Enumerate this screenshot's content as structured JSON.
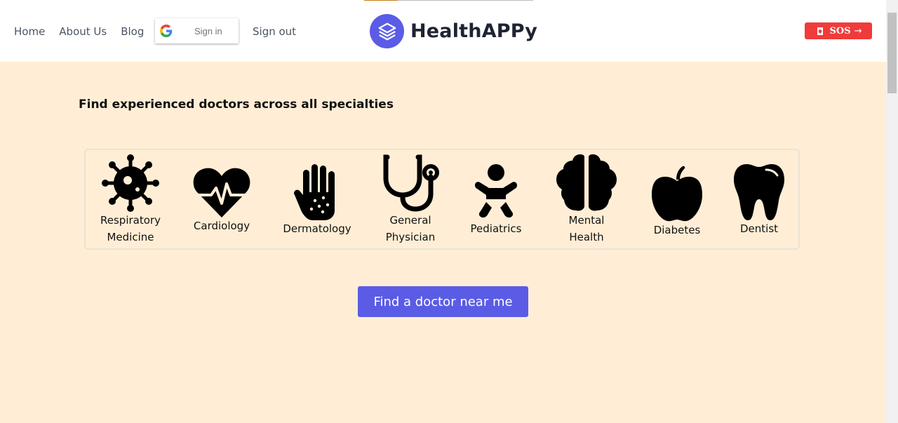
{
  "page": {
    "progress_fraction": 0.2
  },
  "nav": {
    "home": "Home",
    "about": "About Us",
    "blog": "Blog",
    "google_signin": "Sign in",
    "signout": "Sign out"
  },
  "brand": {
    "name": "HealthAPPy",
    "logo_icon": "layers-icon",
    "color": "#5b5ce6"
  },
  "sos": {
    "label": "SOS",
    "color": "#ef3b3b",
    "icon": "flag-icon",
    "arrow": "→"
  },
  "main": {
    "headline": "Find experienced doctors across all specialties",
    "specialties": [
      {
        "label": "Respiratory\nMedicine",
        "icon": "virus-icon"
      },
      {
        "label": "Cardiology",
        "icon": "heart-pulse-icon"
      },
      {
        "label": "Dermatology",
        "icon": "hand-dots-icon"
      },
      {
        "label": "General\nPhysician",
        "icon": "stethoscope-icon"
      },
      {
        "label": "Pediatrics",
        "icon": "baby-icon"
      },
      {
        "label": "Mental\nHealth",
        "icon": "brain-icon"
      },
      {
        "label": "Diabetes",
        "icon": "apple-icon"
      },
      {
        "label": "Dentist",
        "icon": "tooth-icon"
      }
    ],
    "cta": "Find a doctor near me"
  },
  "colors": {
    "background": "#ffeed5",
    "accent": "#5b5ce6"
  }
}
